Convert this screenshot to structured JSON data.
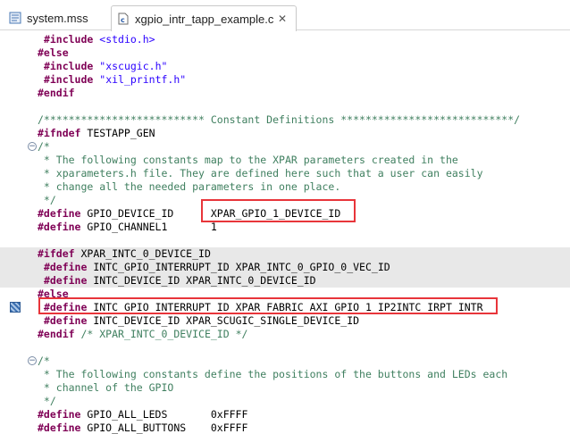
{
  "tabs": [
    {
      "label": "system.mss",
      "active": false
    },
    {
      "label": "xgpio_intr_tapp_example.c",
      "active": true,
      "close": "✕"
    }
  ],
  "lines": [
    {
      "i": 0,
      "indent": " ",
      "parts": [
        {
          "t": "#include",
          "c": "kw"
        },
        {
          "t": " "
        },
        {
          "t": "<stdio.h>",
          "c": "inc"
        }
      ],
      "hl": false
    },
    {
      "i": 1,
      "parts": [
        {
          "t": "#else",
          "c": "kw"
        }
      ]
    },
    {
      "i": 2,
      "indent": " ",
      "parts": [
        {
          "t": "#include",
          "c": "kw"
        },
        {
          "t": " "
        },
        {
          "t": "\"xscugic.h\"",
          "c": "str"
        }
      ]
    },
    {
      "i": 3,
      "indent": " ",
      "parts": [
        {
          "t": "#include",
          "c": "kw"
        },
        {
          "t": " "
        },
        {
          "t": "\"xil_printf.h\"",
          "c": "str"
        }
      ]
    },
    {
      "i": 4,
      "parts": [
        {
          "t": "#endif",
          "c": "kw"
        }
      ]
    },
    {
      "i": 5,
      "parts": []
    },
    {
      "i": 6,
      "parts": [
        {
          "t": "/************************** Constant Definitions ****************************/",
          "c": "com"
        }
      ]
    },
    {
      "i": 7,
      "parts": [
        {
          "t": "#ifndef",
          "c": "kw"
        },
        {
          "t": " TESTAPP_GEN"
        }
      ]
    },
    {
      "i": 8,
      "fold": "−",
      "parts": [
        {
          "t": "/*",
          "c": "com"
        }
      ]
    },
    {
      "i": 9,
      "parts": [
        {
          "t": " * The following constants map to the XPAR parameters created in the",
          "c": "com"
        }
      ]
    },
    {
      "i": 10,
      "parts": [
        {
          "t": " * xparameters.h file. They are defined here such that a user can easily",
          "c": "com"
        }
      ]
    },
    {
      "i": 11,
      "parts": [
        {
          "t": " * change all the needed parameters in one place.",
          "c": "com"
        }
      ]
    },
    {
      "i": 12,
      "parts": [
        {
          "t": " */",
          "c": "com"
        }
      ]
    },
    {
      "i": 13,
      "parts": [
        {
          "t": "#define",
          "c": "kw"
        },
        {
          "t": " GPIO_DEVICE_ID      XPAR_GPIO_1_DEVICE_ID"
        }
      ]
    },
    {
      "i": 14,
      "parts": [
        {
          "t": "#define",
          "c": "kw"
        },
        {
          "t": " GPIO_CHANNEL1       1"
        }
      ]
    },
    {
      "i": 15,
      "parts": []
    },
    {
      "i": 16,
      "hl": true,
      "parts": [
        {
          "t": "#ifdef",
          "c": "kw"
        },
        {
          "t": " XPAR_INTC_0_DEVICE_ID"
        }
      ]
    },
    {
      "i": 17,
      "hl": true,
      "indent": " ",
      "parts": [
        {
          "t": "#define",
          "c": "kw"
        },
        {
          "t": " INTC_GPIO_INTERRUPT_ID XPAR_INTC_0_GPIO_0_VEC_ID"
        }
      ]
    },
    {
      "i": 18,
      "hl": true,
      "indent": " ",
      "parts": [
        {
          "t": "#define",
          "c": "kw"
        },
        {
          "t": " INTC_DEVICE_ID XPAR_INTC_0_DEVICE_ID"
        }
      ]
    },
    {
      "i": 19,
      "parts": [
        {
          "t": "#else",
          "c": "kw"
        }
      ]
    },
    {
      "i": 20,
      "marker": true,
      "indent": " ",
      "parts": [
        {
          "t": "#define",
          "c": "kw"
        },
        {
          "t": " INTC_GPIO_INTERRUPT_ID XPAR_FABRIC_AXI_GPIO_1_IP2INTC_IRPT_INTR"
        }
      ]
    },
    {
      "i": 21,
      "indent": " ",
      "parts": [
        {
          "t": "#define",
          "c": "kw"
        },
        {
          "t": " INTC_DEVICE_ID XPAR_SCUGIC_SINGLE_DEVICE_ID"
        }
      ]
    },
    {
      "i": 22,
      "parts": [
        {
          "t": "#endif",
          "c": "kw"
        },
        {
          "t": " "
        },
        {
          "t": "/* XPAR_INTC_0_DEVICE_ID */",
          "c": "com"
        }
      ]
    },
    {
      "i": 23,
      "parts": []
    },
    {
      "i": 24,
      "fold": "−",
      "parts": [
        {
          "t": "/*",
          "c": "com"
        }
      ]
    },
    {
      "i": 25,
      "parts": [
        {
          "t": " * The following constants define the positions of the buttons and LEDs each",
          "c": "com"
        }
      ]
    },
    {
      "i": 26,
      "parts": [
        {
          "t": " * channel of the GPIO",
          "c": "com"
        }
      ]
    },
    {
      "i": 27,
      "parts": [
        {
          "t": " */",
          "c": "com"
        }
      ]
    },
    {
      "i": 28,
      "parts": [
        {
          "t": "#define",
          "c": "kw"
        },
        {
          "t": " GPIO_ALL_LEDS       0xFFFF"
        }
      ]
    },
    {
      "i": 29,
      "parts": [
        {
          "t": "#define",
          "c": "kw"
        },
        {
          "t": " GPIO_ALL_BUTTONS    0xFFFF"
        }
      ]
    }
  ],
  "colors": {
    "keyword": "#7f0055",
    "string": "#2a00ff",
    "comment": "#3f7f5f",
    "annotation": "#e8353a"
  }
}
